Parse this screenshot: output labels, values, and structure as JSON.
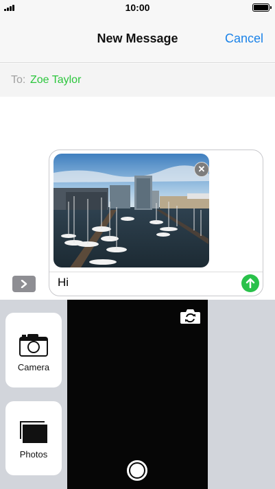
{
  "status_bar": {
    "time": "10:00",
    "signal_icon": "signal-bars-icon",
    "battery_icon": "battery-full-icon"
  },
  "nav": {
    "title": "New Message",
    "cancel_label": "Cancel"
  },
  "recipient": {
    "label": "To:",
    "name": "Zoe Taylor"
  },
  "compose": {
    "attachment": {
      "type": "photo",
      "description_icon": "harbour-photo",
      "remove_icon": "remove-attachment-icon"
    },
    "message_text": "Hi",
    "send_icon": "send-arrow-icon",
    "expand_icon": "chevron-right-icon"
  },
  "picker": {
    "camera_label": "Camera",
    "photos_label": "Photos",
    "camera_icon": "camera-icon",
    "photos_icon": "photo-library-icon",
    "flip_icon": "flip-camera-icon",
    "shutter_icon": "shutter-button"
  },
  "colors": {
    "accent_blue": "#1a82e8",
    "contact_green": "#2bc63c",
    "send_green": "#29c14a",
    "picker_bg": "#d2d5db",
    "viewfinder_bg": "#060606"
  }
}
